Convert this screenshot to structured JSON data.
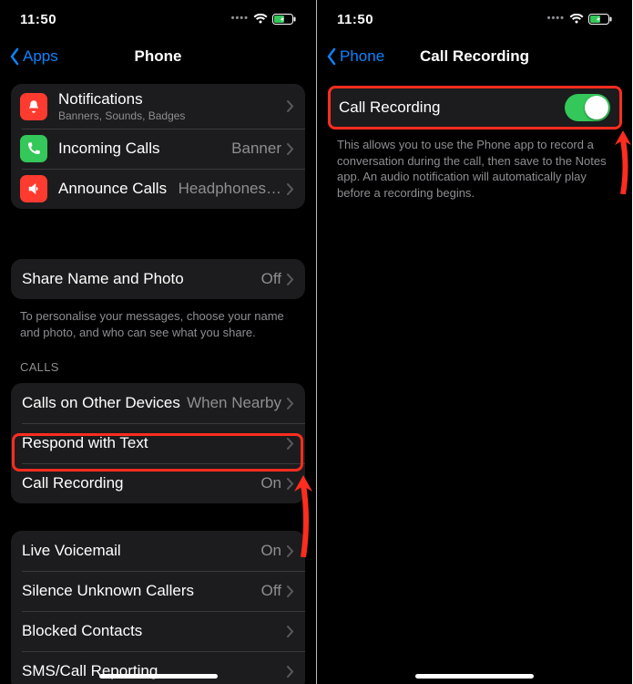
{
  "status": {
    "time": "11:50"
  },
  "left": {
    "back": "Apps",
    "title": "Phone",
    "group1": {
      "notifications": {
        "label": "Notifications",
        "sub": "Banners, Sounds, Badges"
      },
      "incoming": {
        "label": "Incoming Calls",
        "value": "Banner"
      },
      "announce": {
        "label": "Announce Calls",
        "value": "Headphones…"
      }
    },
    "share": {
      "label": "Share Name and Photo",
      "value": "Off"
    },
    "shareFoot": "To personalise your messages, choose your name and photo, and who can see what you share.",
    "callsHeader": "CALLS",
    "calls": {
      "other": {
        "label": "Calls on Other Devices",
        "value": "When Nearby"
      },
      "respond": {
        "label": "Respond with Text"
      },
      "record": {
        "label": "Call Recording",
        "value": "On"
      }
    },
    "group3": {
      "live": {
        "label": "Live Voicemail",
        "value": "On"
      },
      "silence": {
        "label": "Silence Unknown Callers",
        "value": "Off"
      },
      "blocked": {
        "label": "Blocked Contacts"
      },
      "sms": {
        "label": "SMS/Call Reporting"
      }
    }
  },
  "right": {
    "back": "Phone",
    "title": "Call Recording",
    "toggle": {
      "label": "Call Recording",
      "on": true
    },
    "foot": "This allows you to use the Phone app to record a conversation during the call, then save to the Notes app. An audio notification will automatically play before a recording begins."
  }
}
